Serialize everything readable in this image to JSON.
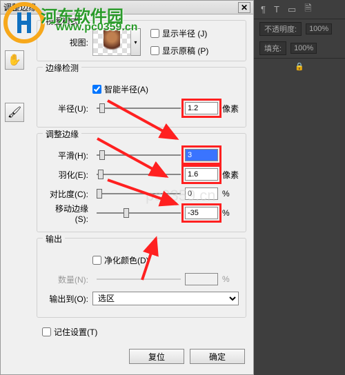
{
  "dialog": {
    "title": "调整边缘"
  },
  "watermark": {
    "brand": "河东软件园",
    "url": "www.pc0359.cn",
    "center": "pc0359.cn"
  },
  "viewmode": {
    "group": "视图模式",
    "view_label": "视图:",
    "show_radius": "显示半径 (J)",
    "show_original": "显示原稿 (P)"
  },
  "edge": {
    "group": "边缘检测",
    "smart": "智能半径(A)",
    "radius_label": "半径(U):",
    "radius_value": "1.2",
    "unit_px": "像素"
  },
  "adjust": {
    "group": "调整边缘",
    "smooth_label": "平滑(H):",
    "smooth_value": "3",
    "feather_label": "羽化(E):",
    "feather_value": "1.6",
    "feather_unit": "像素",
    "contrast_label": "对比度(C):",
    "contrast_value": "0",
    "shift_label": "移动边缘(S):",
    "shift_value": "-35",
    "pct": "%"
  },
  "output": {
    "group": "输出",
    "decon": "净化颜色(D)",
    "amount_label": "数量(N):",
    "amount_value": "",
    "target_label": "输出到(O):",
    "target_value": "选区"
  },
  "remember": "记住设置(T)",
  "buttons": {
    "reset": "复位",
    "ok": "确定"
  },
  "right": {
    "opacity_label": "不透明度:",
    "opacity_value": "100%",
    "fill_label": "填充:",
    "fill_value": "100%"
  }
}
